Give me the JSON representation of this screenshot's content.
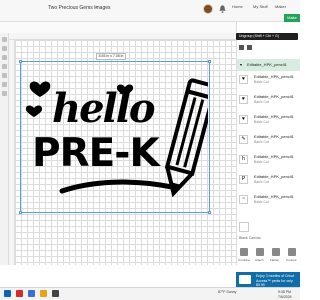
{
  "window": {
    "project_title": "Two Precious Gems Images"
  },
  "header": {
    "chevron": "⌄",
    "nav": [
      "Home",
      "My Stuff",
      "Maker",
      "Make"
    ],
    "sync": "Unsync"
  },
  "canvas": {
    "size_label": "8.55 in x 7.08 in",
    "art_line1": "hello",
    "art_line2": "PRE-K"
  },
  "panel": {
    "tooltip": "Ungroup (Shift + Ctrl + G)",
    "group_name": "Editable_HPK_pencil1",
    "layers": [
      {
        "name": "Editable_HPK_pencil1",
        "type": "Basic Cut"
      },
      {
        "name": "Editable_HPK_pencil1",
        "type": "Basic Cut"
      },
      {
        "name": "Editable_HPK_pencil1",
        "type": "Basic Cut"
      },
      {
        "name": "Editable_HPK_pencil1",
        "type": "Basic Cut"
      },
      {
        "name": "Editable_HPK_pencil1",
        "type": "Basic Cut"
      },
      {
        "name": "Editable_HPK_pencil1",
        "type": "Basic Cut"
      },
      {
        "name": "Editable_HPK_pencil1",
        "type": "Basic Cut"
      }
    ],
    "blank_canvas": "Blank Canvas",
    "bottom_actions": [
      "Combine",
      "Attach",
      "Flatten",
      "Contour"
    ]
  },
  "promo": {
    "text": "Enjoy 3 months of Cricut Access™ perks for only $9.99"
  },
  "taskbar": {
    "weather": "87°F Sunny",
    "time": "9:38 PM",
    "date": "7/6/2024"
  },
  "colors": {
    "make_green": "#22a35a",
    "selection_blue": "#5aa0e6",
    "promo_blue": "#0f6ea8",
    "layer_highlight": "#d8ece0"
  }
}
